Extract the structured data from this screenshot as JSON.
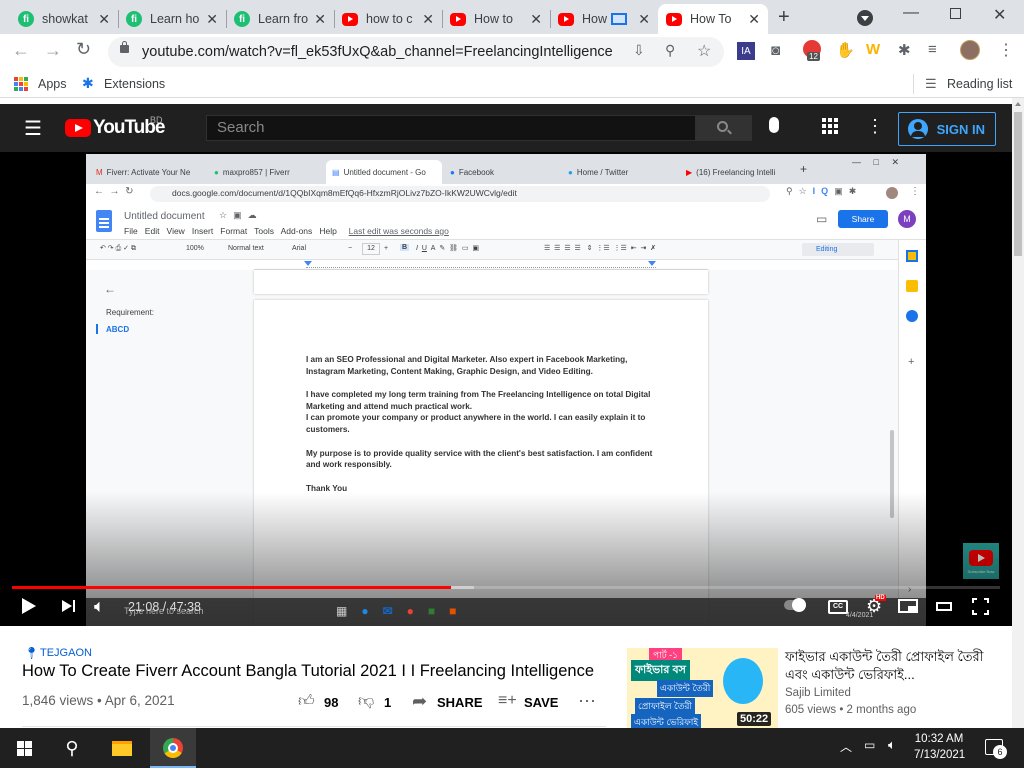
{
  "browser": {
    "tabs": [
      {
        "title": "showkat",
        "icon": "fiverr"
      },
      {
        "title": "Learn ho",
        "icon": "fiverr"
      },
      {
        "title": "Learn fro",
        "icon": "fiverr"
      },
      {
        "title": "how to c",
        "icon": "youtube"
      },
      {
        "title": "How to",
        "icon": "youtube"
      },
      {
        "title": "How",
        "icon": "youtube"
      },
      {
        "title": "How To",
        "icon": "youtube",
        "active": true
      }
    ],
    "url": "youtube.com/watch?v=fl_ek53fUxQ&ab_channel=FreelancingIntelligence",
    "ext_badge": "12",
    "ext_ia": "IA",
    "bookmarks": {
      "apps": "Apps",
      "extensions": "Extensions",
      "reading_list": "Reading list"
    }
  },
  "youtube": {
    "logo": "YouTube",
    "region": "BD",
    "search_placeholder": "Search",
    "sign_in": "SIGN IN",
    "player": {
      "time": "21:08 / 47:38",
      "progress": 0.444,
      "buffered": 0.468,
      "cc": "CC",
      "hd": "HD"
    },
    "video": {
      "location": "TEJGAON",
      "title": "How To Create Fiverr Account Bangla Tutorial 2021 I I Freelancing Intelligence",
      "meta": "1,846 views • Apr 6, 2021",
      "likes": "98",
      "dislikes": "1",
      "share": "SHARE",
      "save": "SAVE"
    },
    "recommended": {
      "title": "ফাইভার একাউন্ট তৈরী প্রোফাইল তৈরী এবং একাউন্ট ভেরিফাই...",
      "channel": "Sajib Limited",
      "meta": "605 views • 2 months ago",
      "duration": "50:22",
      "thumb_lines": [
        "পার্ট -১",
        "ফাইভার বস",
        "একাউন্ট তৈরী",
        "প্রোফাইল তৈরী",
        "একাউন্ট ভেরিফাই"
      ]
    }
  },
  "inner_screen": {
    "tabs": [
      "Fiverr: Activate Your Ne",
      "maxpro857 | Fiverr",
      "Untitled document - Go",
      "Facebook",
      "Home / Twitter",
      "(16) Freelancing Intelli"
    ],
    "url": "docs.google.com/document/d/1QQbIXqm8mEfQq6-HfxzmRjOLivz7bZO-IkKW2UWCvlg/edit",
    "doc_title": "Untitled document",
    "menu": [
      "File",
      "Edit",
      "View",
      "Insert",
      "Format",
      "Tools",
      "Add-ons",
      "Help"
    ],
    "last_edit": "Last edit was seconds ago",
    "share": "Share",
    "avatar": "M",
    "zoom": "100%",
    "style": "Normal text",
    "font": "Arial",
    "font_size": "12",
    "mode": "Editing",
    "outline_heading": "Requirement:",
    "outline_item": "ABCD",
    "paragraphs": [
      "I am an SEO Professional and Digital Marketer. Also expert in Facebook Marketing, Instagram Marketing, Content Making, Graphic Design, and Video Editing.",
      "I have completed my long term training from The Freelancing Intelligence on total Digital Marketing and attend much practical work.\nI can promote your company or product anywhere in the world. I can easily explain it to customers.",
      "My purpose is to provide quality service with the client's best satisfaction. I am confident and work responsibly.",
      "Thank You"
    ],
    "taskbar_search": "Type here to search",
    "clock_time": "4/4/2021",
    "subscribe": "Subscribe Now"
  },
  "taskbar": {
    "time": "10:32 AM",
    "date": "7/13/2021",
    "notifications": "6"
  }
}
